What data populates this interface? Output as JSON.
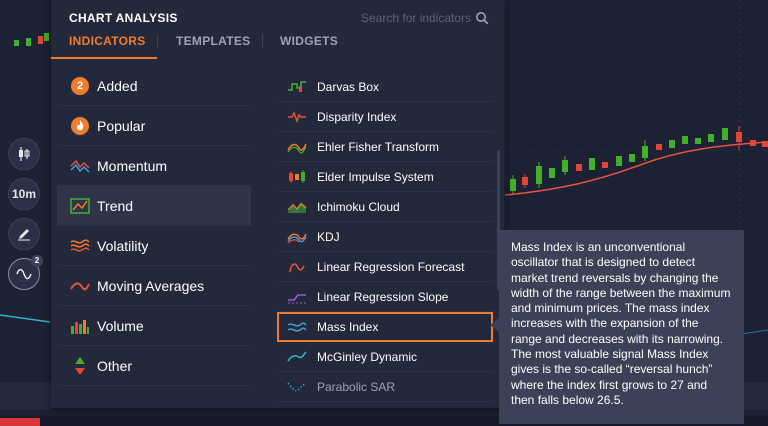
{
  "panel": {
    "title": "CHART ANALYSIS",
    "search_placeholder": "Search for indicators",
    "tabs": [
      {
        "label": "INDICATORS",
        "active": true
      },
      {
        "label": "TEMPLATES",
        "active": false
      },
      {
        "label": "WIDGETS",
        "active": false
      }
    ]
  },
  "left_toolbar": {
    "timeframe_label": "10m",
    "indicators_badge": "2"
  },
  "categories": [
    {
      "label": "Added",
      "badge": "2",
      "icon": "count-badge-icon"
    },
    {
      "label": "Popular",
      "icon": "flame-icon"
    },
    {
      "label": "Momentum",
      "icon": "momentum-waves-icon"
    },
    {
      "label": "Trend",
      "icon": "trend-chart-icon",
      "active": true
    },
    {
      "label": "Volatility",
      "icon": "volatility-waves-icon"
    },
    {
      "label": "Moving Averages",
      "icon": "moving-average-icon"
    },
    {
      "label": "Volume",
      "icon": "volume-bars-icon"
    },
    {
      "label": "Other",
      "icon": "arrows-up-down-icon"
    }
  ],
  "indicators": [
    {
      "label": "Darvas Box",
      "icon": "darvas-box-icon"
    },
    {
      "label": "Disparity Index",
      "icon": "disparity-index-icon"
    },
    {
      "label": "Ehler Fisher Transform",
      "icon": "ehler-fisher-icon"
    },
    {
      "label": "Elder Impulse System",
      "icon": "elder-impulse-icon"
    },
    {
      "label": "Ichimoku Cloud",
      "icon": "ichimoku-cloud-icon"
    },
    {
      "label": "KDJ",
      "icon": "kdj-icon"
    },
    {
      "label": "Linear Regression Forecast",
      "icon": "linear-regression-forecast-icon"
    },
    {
      "label": "Linear Regression Slope",
      "icon": "linear-regression-slope-icon"
    },
    {
      "label": "Mass Index",
      "icon": "mass-index-icon",
      "selected": true
    },
    {
      "label": "McGinley Dynamic",
      "icon": "mcginley-dynamic-icon"
    },
    {
      "label": "Parabolic SAR",
      "icon": "parabolic-sar-icon"
    }
  ],
  "tooltip": {
    "text": "Mass Index is an unconventional oscillator that is designed to detect market trend reversals by changing the width of the range between the maximum and minimum prices. The mass index increases with the expansion of the range and decreases with its narrowing. The most valuable signal Mass Index gives is the so-called “reversal hunch” where the index first grows to 27 and then falls below 26.5."
  },
  "colors": {
    "accent": "#f27c2e",
    "panel_bg": "#23283a",
    "page_bg": "#1c2133",
    "candle_up": "#43b02a",
    "candle_down": "#e0463a",
    "ma_line": "#e5533d",
    "tooltip_bg": "#3b4156"
  }
}
